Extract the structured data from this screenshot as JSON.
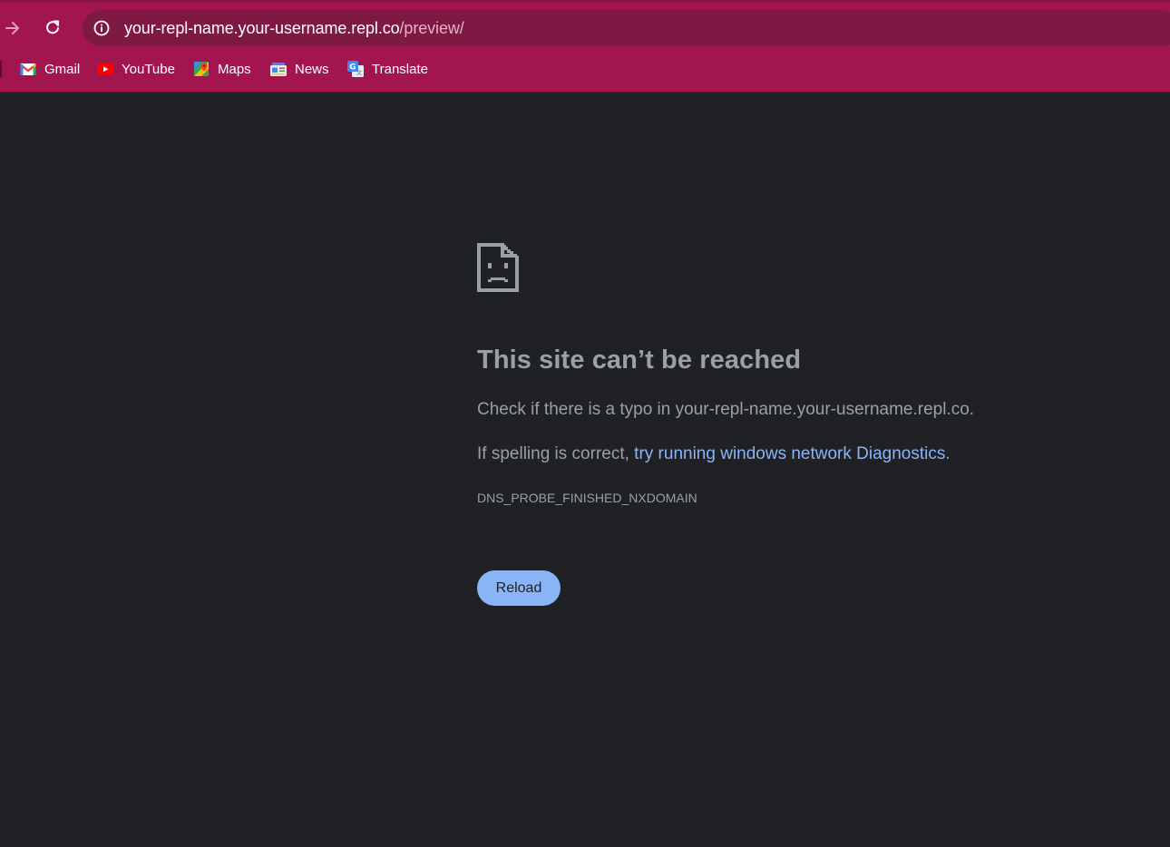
{
  "browser": {
    "url_host": "your-repl-name.your-username.repl.co",
    "url_path": "/preview/",
    "nav": {
      "forward_icon": "arrow-right-icon",
      "reload_icon": "reload-icon",
      "site_info_icon": "info-icon"
    },
    "colors": {
      "toolbar": "#a3154f",
      "omnibox": "#7d1943",
      "page_background": "#202124",
      "link": "#8ab4f8"
    }
  },
  "bookmarks": [
    {
      "label": "Gmail",
      "icon": "gmail-icon"
    },
    {
      "label": "YouTube",
      "icon": "youtube-icon"
    },
    {
      "label": "Maps",
      "icon": "maps-icon"
    },
    {
      "label": "News",
      "icon": "news-icon"
    },
    {
      "label": "Translate",
      "icon": "translate-icon"
    }
  ],
  "error": {
    "icon": "sad-page-icon",
    "title": "This site can’t be reached",
    "typo_prefix": "Check if there is a typo in ",
    "typo_host": "your-repl-name.your-username.repl.co",
    "typo_suffix": ".",
    "spelling_prefix": "If spelling is correct, ",
    "diagnostics_link": "try running windows network Diagnostics",
    "spelling_suffix": ".",
    "code": "DNS_PROBE_FINISHED_NXDOMAIN",
    "reload_label": "Reload"
  }
}
